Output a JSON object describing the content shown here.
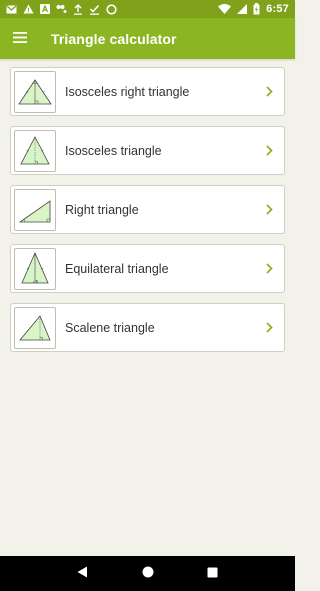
{
  "status_bar": {
    "time": "6:57",
    "icons": [
      "gmail-icon",
      "alert-icon",
      "a-icon",
      "share-dots-icon",
      "upload-icon",
      "check-download-icon",
      "circle-icon",
      "wifi-icon",
      "signal-icon",
      "battery-icon"
    ]
  },
  "app_bar": {
    "title": "Triangle calculator",
    "menu_icon": "hamburger-menu-icon"
  },
  "items": [
    {
      "label": "Isosceles right triangle",
      "icon": "isosceles-right-triangle-icon"
    },
    {
      "label": "Isosceles triangle",
      "icon": "isosceles-triangle-icon"
    },
    {
      "label": "Right triangle",
      "icon": "right-triangle-icon"
    },
    {
      "label": "Equilateral triangle",
      "icon": "equilateral-triangle-icon"
    },
    {
      "label": "Scalene triangle",
      "icon": "scalene-triangle-icon"
    }
  ],
  "colors": {
    "status_bar": "#7fa21a",
    "app_bar": "#8cb522",
    "background": "#f2f1ea",
    "chevron": "#8cb522",
    "triangle_fill": "#d9f5c8"
  },
  "nav_bar": {
    "icons": [
      "back-icon",
      "home-icon",
      "recents-icon"
    ]
  }
}
